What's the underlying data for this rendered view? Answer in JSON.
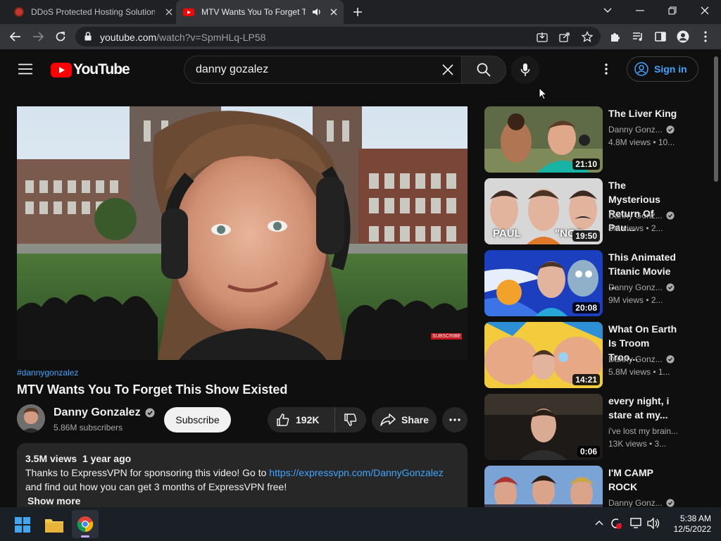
{
  "browser": {
    "tabs": [
      {
        "title": "DDoS Protected Hosting Solution",
        "active": false
      },
      {
        "title": "MTV Wants You To Forget Th",
        "active": true
      }
    ],
    "url_domain": "youtube.com",
    "url_path": "/watch?v=SpmHLq-LP58"
  },
  "header": {
    "logo_text": "YouTube",
    "search_value": "danny gozalez",
    "signin_label": "Sign in"
  },
  "video": {
    "hashtag": "#dannygonzalez",
    "title": "MTV Wants You To Forget This Show Existed",
    "channel": "Danny Gonzalez",
    "subscribers": "5.86M subscribers",
    "subscribe_label": "Subscribe",
    "likes": "192K",
    "share_label": "Share",
    "player_sub_label": "SUBSCRIBE"
  },
  "description": {
    "views": "3.5M views",
    "age": "1 year ago",
    "text_before_link": "Thanks to ExpressVPN for sponsoring this video! Go to ",
    "link": "https://expressvpn.com/DannyGonzalez",
    "text_after_link": "and find out how you can get 3 months of ExpressVPN free!",
    "show_more": "Show more"
  },
  "related": [
    {
      "title": "The Liver King",
      "channel": "Danny Gonz...",
      "stats": "4.8M views  • 10...",
      "duration": "21:10"
    },
    {
      "title": "The Mysterious Return Of Pau...",
      "channel": "Danny Gonz...",
      "stats": "8M views  • 2...",
      "duration": "19:50",
      "thumb_text_a": "PAUL",
      "thumb_text_b": "\"NOT"
    },
    {
      "title": "This Animated Titanic Movie ...",
      "channel": "Danny Gonz...",
      "stats": "9M views  • 2...",
      "duration": "20:08"
    },
    {
      "title": "What On Earth Is Troom Troo...",
      "channel": "Danny Gonz...",
      "stats": "5.8M views  • 1...",
      "duration": "14:21"
    },
    {
      "title": "every night, i stare at my...",
      "channel": "i've lost my brain...",
      "stats": "13K views  • 3...",
      "duration": "0:06"
    },
    {
      "title": "I'M CAMP ROCK",
      "channel": "Danny Gonz...",
      "stats": "",
      "duration": ""
    }
  ],
  "taskbar": {
    "time": "5:38 AM",
    "date": "12/5/2022"
  },
  "colors": {
    "yt_red": "#ff0000",
    "link_blue": "#3ea6ff",
    "background": "#0f0f0f"
  }
}
